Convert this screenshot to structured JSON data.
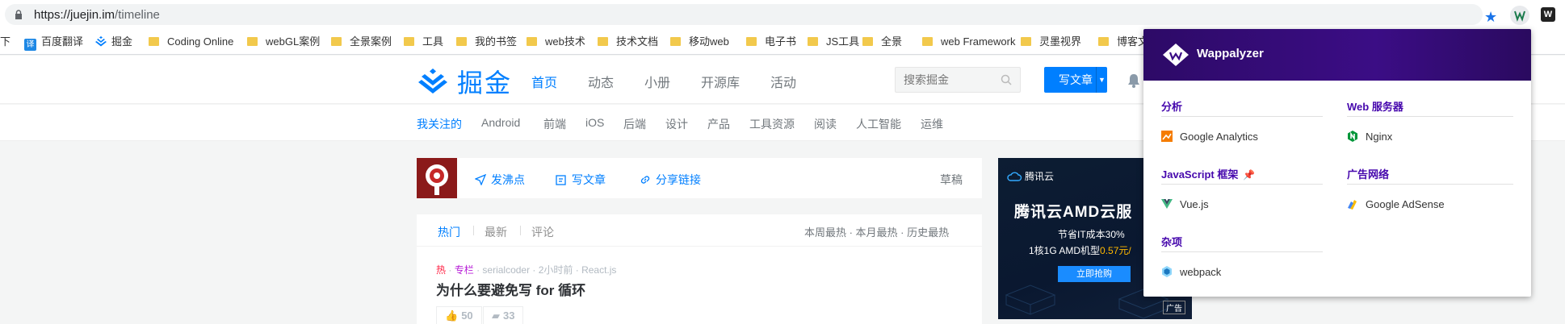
{
  "browser": {
    "url_host": "https://juejin.im",
    "url_path": "/timeline",
    "tw_ext_label": "W"
  },
  "bookmarks": [
    {
      "label": "下",
      "icon": "none"
    },
    {
      "label": "百度翻译",
      "icon": "translate-icon",
      "glyph": "译"
    },
    {
      "label": "掘金",
      "icon": "juejin-icon"
    },
    {
      "label": "Coding Online",
      "icon": "folder-icon"
    },
    {
      "label": "webGL案例",
      "icon": "folder-icon"
    },
    {
      "label": "全景案例",
      "icon": "folder-icon"
    },
    {
      "label": "工具",
      "icon": "folder-icon"
    },
    {
      "label": "我的书签",
      "icon": "folder-icon"
    },
    {
      "label": "web技术",
      "icon": "folder-icon"
    },
    {
      "label": "技术文档",
      "icon": "folder-icon"
    },
    {
      "label": "移动web",
      "icon": "folder-icon"
    },
    {
      "label": "电子书",
      "icon": "folder-icon"
    },
    {
      "label": "JS工具",
      "icon": "folder-icon"
    },
    {
      "label": "全景",
      "icon": "folder-icon"
    },
    {
      "label": "web Framework",
      "icon": "folder-icon"
    },
    {
      "label": "灵墨视界",
      "icon": "folder-icon"
    },
    {
      "label": "博客文章",
      "icon": "folder-icon"
    }
  ],
  "header": {
    "logo_text": "掘金",
    "nav": [
      "首页",
      "动态",
      "小册",
      "开源库",
      "活动"
    ],
    "search_placeholder": "搜索掘金",
    "write_label": "写文章"
  },
  "subnav": [
    "我关注的",
    "Android",
    "前端",
    "iOS",
    "后端",
    "设计",
    "产品",
    "工具资源",
    "阅读",
    "人工智能",
    "运维"
  ],
  "postbar": {
    "actions": [
      "发沸点",
      "写文章",
      "分享链接"
    ],
    "drafts": "草稿"
  },
  "feed": {
    "tabs": [
      "热门",
      "最新",
      "评论"
    ],
    "ranges": "本周最热 · 本月最热 · 历史最热",
    "item": {
      "hot": "热",
      "column": "专栏",
      "meta": "· serialcoder · 2小时前 · React.js",
      "title": "为什么要避免写 for 循环",
      "likes": "50",
      "comments": "33"
    }
  },
  "ad": {
    "brand": "腾讯云",
    "title": "腾讯云AMD云服",
    "line1": "节省IT成本30%",
    "line2_pre": "1核1G AMD机型",
    "line2_price": "0.57元/",
    "button": "立即抢购",
    "tag": "广告"
  },
  "wappalyzer": {
    "title": "Wappalyzer",
    "left": [
      {
        "category": "分析",
        "items": [
          {
            "name": "Google Analytics",
            "icon": "google-analytics-icon"
          }
        ]
      },
      {
        "category": "JavaScript 框架",
        "pinned": true,
        "items": [
          {
            "name": "Vue.js",
            "icon": "vuejs-icon"
          }
        ]
      },
      {
        "category": "杂项",
        "items": [
          {
            "name": "webpack",
            "icon": "webpack-icon"
          }
        ]
      }
    ],
    "right": [
      {
        "category": "Web 服务器",
        "items": [
          {
            "name": "Nginx",
            "icon": "nginx-icon"
          }
        ]
      },
      {
        "category": "广告网络",
        "items": [
          {
            "name": "Google AdSense",
            "icon": "google-adsense-icon"
          }
        ]
      }
    ]
  },
  "colors": {
    "accent": "#007fff",
    "wappalyzer_purple": "#4608ad"
  }
}
